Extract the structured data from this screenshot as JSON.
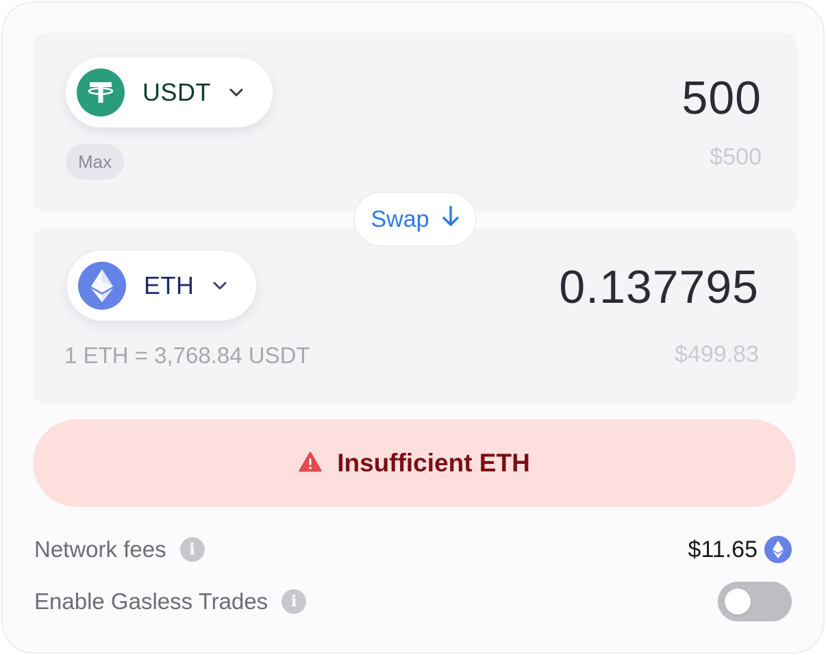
{
  "from": {
    "token_symbol": "USDT",
    "token_icon": "tether-icon",
    "token_color": "#2a9d7d",
    "amount": "500",
    "usd_value": "$500",
    "max_label": "Max"
  },
  "swap": {
    "label": "Swap",
    "icon": "arrow-down-icon",
    "color": "#2c7be5"
  },
  "to": {
    "token_symbol": "ETH",
    "token_icon": "ethereum-icon",
    "token_color": "#6583e6",
    "amount": "0.137795",
    "usd_value": "$499.83",
    "rate": "1 ETH = 3,768.84 USDT"
  },
  "action": {
    "label": "Insufficient ETH",
    "icon": "warning-icon",
    "background": "#fde0dd",
    "text_color": "#7a0e14",
    "icon_color": "#e5484d"
  },
  "fees": {
    "label": "Network fees",
    "value": "$11.65",
    "icon": "ethereum-icon"
  },
  "gasless": {
    "label": "Enable Gasless Trades",
    "enabled": false
  }
}
